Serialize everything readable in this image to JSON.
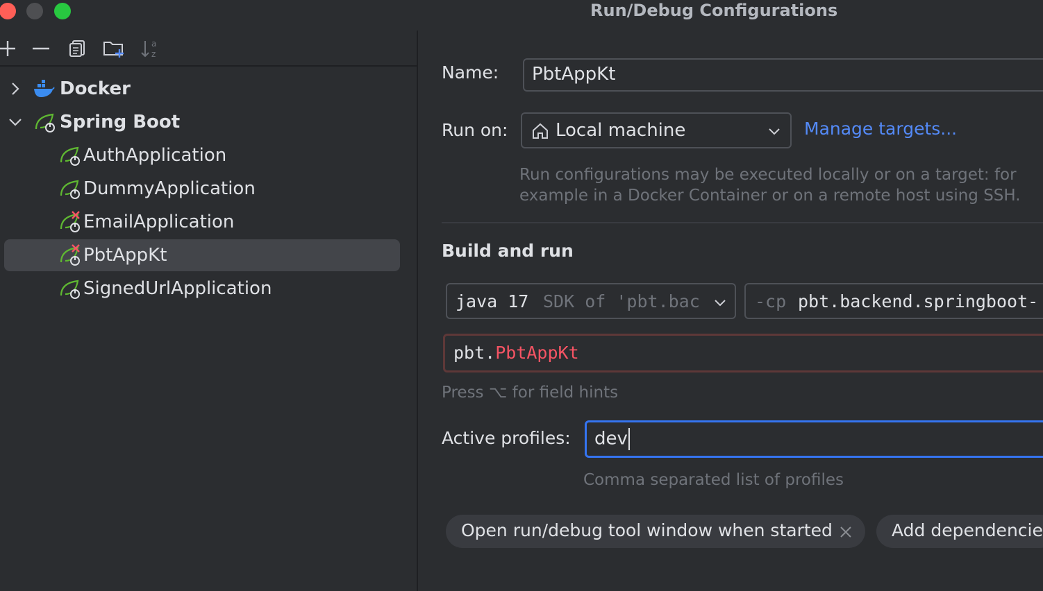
{
  "window": {
    "title": "Run/Debug Configurations"
  },
  "colors": {
    "close": "#ff5f57",
    "minimize": "#4e4f52",
    "maximize": "#28c840",
    "accent": "#3574f0",
    "link": "#548af7",
    "error": "#f75464",
    "spring": "#5fb832"
  },
  "toolbar": {
    "icons": [
      "add-icon",
      "remove-icon",
      "copy-icon",
      "new-folder-icon",
      "sort-icon"
    ]
  },
  "tree": {
    "docker": "Docker",
    "spring_boot": "Spring Boot",
    "items": [
      {
        "label": "AuthApplication",
        "error": false
      },
      {
        "label": "DummyApplication",
        "error": false
      },
      {
        "label": "EmailApplication",
        "error": true
      },
      {
        "label": "PbtAppKt",
        "error": true,
        "selected": true
      },
      {
        "label": "SignedUrlApplication",
        "error": false
      }
    ]
  },
  "form": {
    "name_label": "Name:",
    "name_value": "PbtAppKt",
    "run_on_label": "Run on:",
    "run_on_value": "Local machine",
    "manage_targets": "Manage targets...",
    "run_on_hint_line1": "Run configurations may be executed locally or on a target: for",
    "run_on_hint_line2": "example in a Docker Container or on a remote host using SSH.",
    "build_and_run": "Build and run",
    "jdk_main": "java 17",
    "jdk_detail": "SDK of 'pbt.bac",
    "cp_prefix": "-cp",
    "cp_value": "pbt.backend.springboot-",
    "main_class_pkg": "pbt.",
    "main_class_name": "PbtAppKt",
    "field_hints": "Press ⌥ for field hints",
    "profiles_label": "Active profiles:",
    "profiles_value": "dev",
    "profiles_hint": "Comma separated list of profiles",
    "chip_open_window": "Open run/debug tool window when started",
    "chip_add_dependencies": "Add dependencie"
  }
}
